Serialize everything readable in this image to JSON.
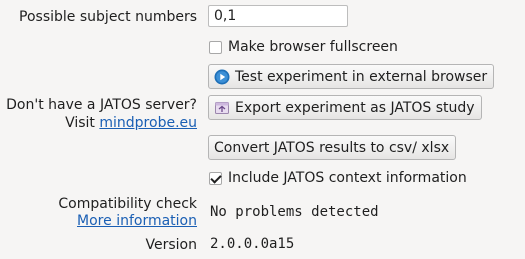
{
  "subject_numbers": {
    "label": "Possible subject numbers",
    "value": "0,1"
  },
  "fullscreen": {
    "label": "Make browser fullscreen",
    "checked": false
  },
  "test_button": {
    "label": "Test experiment in external browser",
    "icon": "play-icon"
  },
  "jatos_server": {
    "line1": "Don't have a JATOS server?",
    "visit_label": "Visit",
    "link_text": "mindprobe.eu"
  },
  "export_button": {
    "label": "Export experiment as JATOS study",
    "icon": "export-icon"
  },
  "convert_button": {
    "label": "Convert JATOS results to csv/ xlsx"
  },
  "context_info": {
    "label": "Include JATOS context information",
    "checked": true
  },
  "compatibility": {
    "label": "Compatibility check",
    "link_text": "More information",
    "result": "No problems detected"
  },
  "version": {
    "label": "Version",
    "value": "2.0.0.0a15"
  },
  "colors": {
    "background": "#f6f5f4",
    "link": "#1a5fb4",
    "play_icon": "#1d6fb8"
  }
}
